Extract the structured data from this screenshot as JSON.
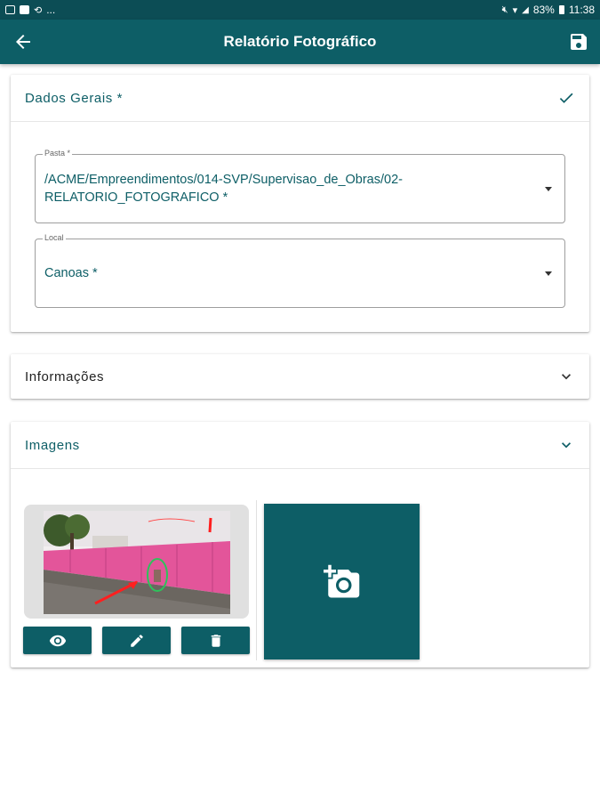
{
  "statusbar": {
    "left_text": "...",
    "battery": "83%",
    "time": "11:38"
  },
  "appbar": {
    "title": "Relatório Fotográfico"
  },
  "dados_gerais": {
    "title": "Dados Gerais *",
    "pasta": {
      "label": "Pasta *",
      "value": "/ACME/Empreendimentos/014-SVP/Supervisao_de_Obras/02-RELATORIO_FOTOGRAFICO *"
    },
    "local": {
      "label": "Local",
      "value": "Canoas *"
    }
  },
  "informacoes": {
    "title": "Informações"
  },
  "imagens": {
    "title": "Imagens"
  },
  "colors": {
    "primary": "#0d5e66",
    "statusbar": "#0c4d55"
  }
}
